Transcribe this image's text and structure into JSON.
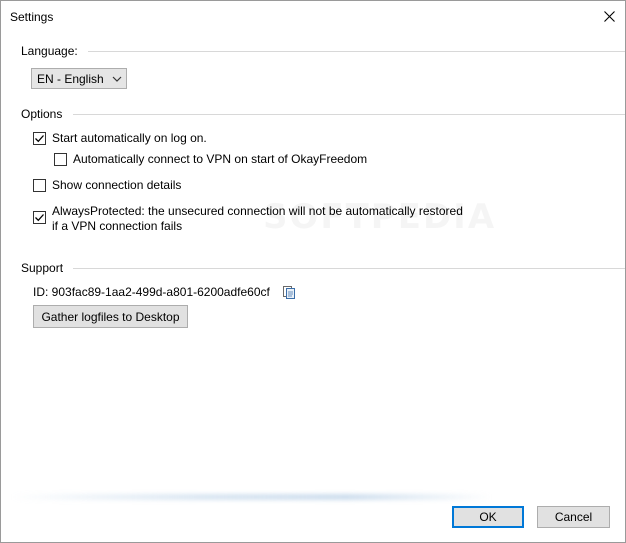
{
  "window": {
    "title": "Settings",
    "close_glyph": "close-icon"
  },
  "language": {
    "group_label": "Language:",
    "selected": "EN - English"
  },
  "options": {
    "group_label": "Options",
    "items": [
      {
        "label_lines": [
          "Start automatically on log on."
        ],
        "checked": true
      },
      {
        "label_lines": [
          "Automatically connect to VPN on start of OkayFreedom"
        ],
        "checked": false
      },
      {
        "label_lines": [
          "Show connection details"
        ],
        "checked": false
      },
      {
        "label_lines": [
          "AlwaysProtected: the unsecured connection will not be automatically restored",
          "if a VPN connection fails"
        ],
        "checked": true
      }
    ]
  },
  "support": {
    "group_label": "Support",
    "id_text": "ID: 903fac89-1aa2-499d-a801-6200adfe60cf",
    "gather_button": "Gather logfiles to Desktop"
  },
  "footer": {
    "ok_label": "OK",
    "cancel_label": "Cancel"
  },
  "colors": {
    "accent": "#0078d7",
    "button_bg": "#e1e1e1",
    "line": "#d8d8d8"
  }
}
